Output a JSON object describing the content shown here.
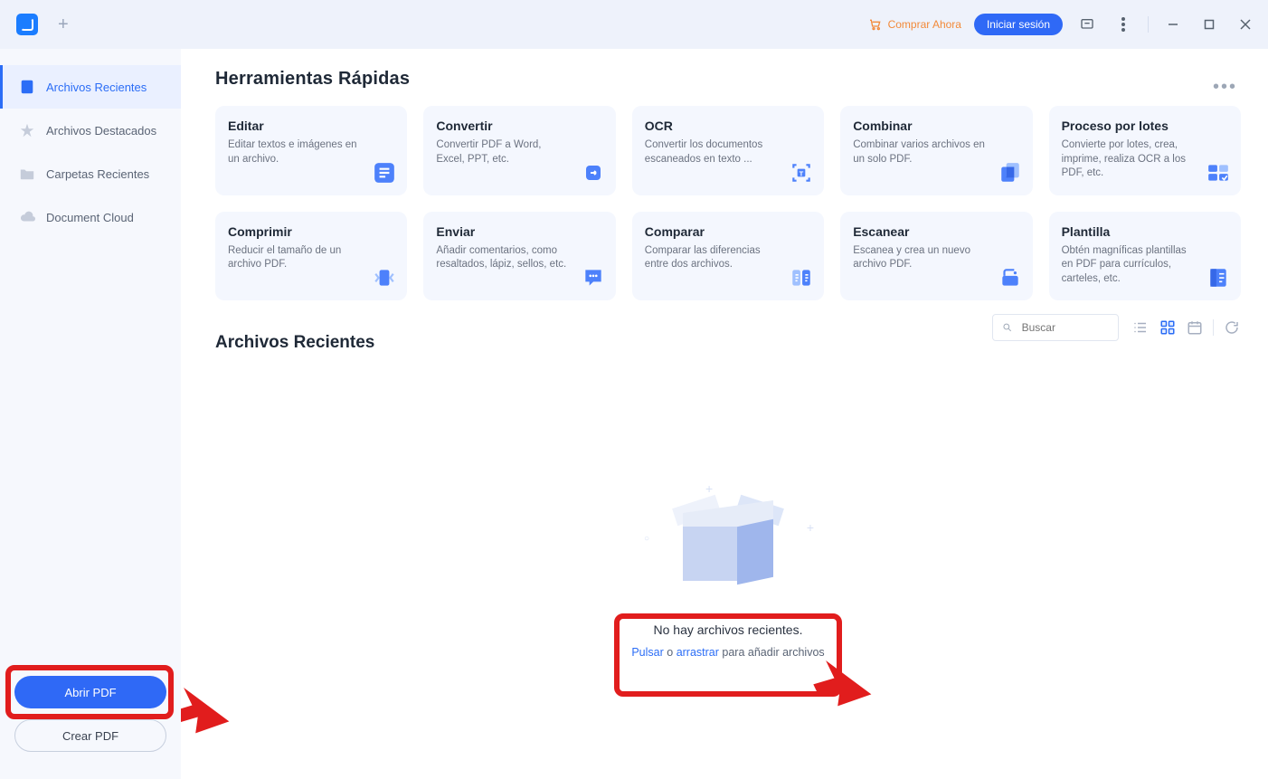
{
  "titlebar": {
    "buy_label": "Comprar Ahora",
    "login_label": "Iniciar sesión"
  },
  "sidebar": {
    "items": [
      {
        "label": "Archivos Recientes"
      },
      {
        "label": "Archivos Destacados"
      },
      {
        "label": "Carpetas Recientes"
      },
      {
        "label": "Document Cloud"
      }
    ],
    "open_pdf": "Abrir PDF",
    "create_pdf": "Crear PDF"
  },
  "sections": {
    "tools_heading": "Herramientas Rápidas",
    "recent_heading": "Archivos Recientes"
  },
  "tools": [
    {
      "title": "Editar",
      "desc": "Editar textos e imágenes en un archivo."
    },
    {
      "title": "Convertir",
      "desc": "Convertir PDF a Word, Excel, PPT, etc."
    },
    {
      "title": "OCR",
      "desc": "Convertir los documentos escaneados en texto ..."
    },
    {
      "title": "Combinar",
      "desc": "Combinar varios archivos en un solo PDF."
    },
    {
      "title": "Proceso por lotes",
      "desc": "Convierte por lotes, crea, imprime, realiza OCR a los PDF, etc."
    },
    {
      "title": "Comprimir",
      "desc": "Reducir el tamaño de un archivo PDF."
    },
    {
      "title": "Enviar",
      "desc": "Añadir comentarios, como resaltados, lápiz, sellos, etc."
    },
    {
      "title": "Comparar",
      "desc": "Comparar las diferencias entre dos archivos."
    },
    {
      "title": "Escanear",
      "desc": "Escanea y crea un nuevo archivo PDF."
    },
    {
      "title": "Plantilla",
      "desc": "Obtén magníficas plantillas en PDF para currículos, carteles, etc."
    }
  ],
  "search": {
    "placeholder": "Buscar"
  },
  "empty": {
    "headline": "No hay archivos recientes.",
    "click": "Pulsar",
    "or": " o ",
    "drag": "arrastrar",
    "tail": " para añadir archivos"
  }
}
